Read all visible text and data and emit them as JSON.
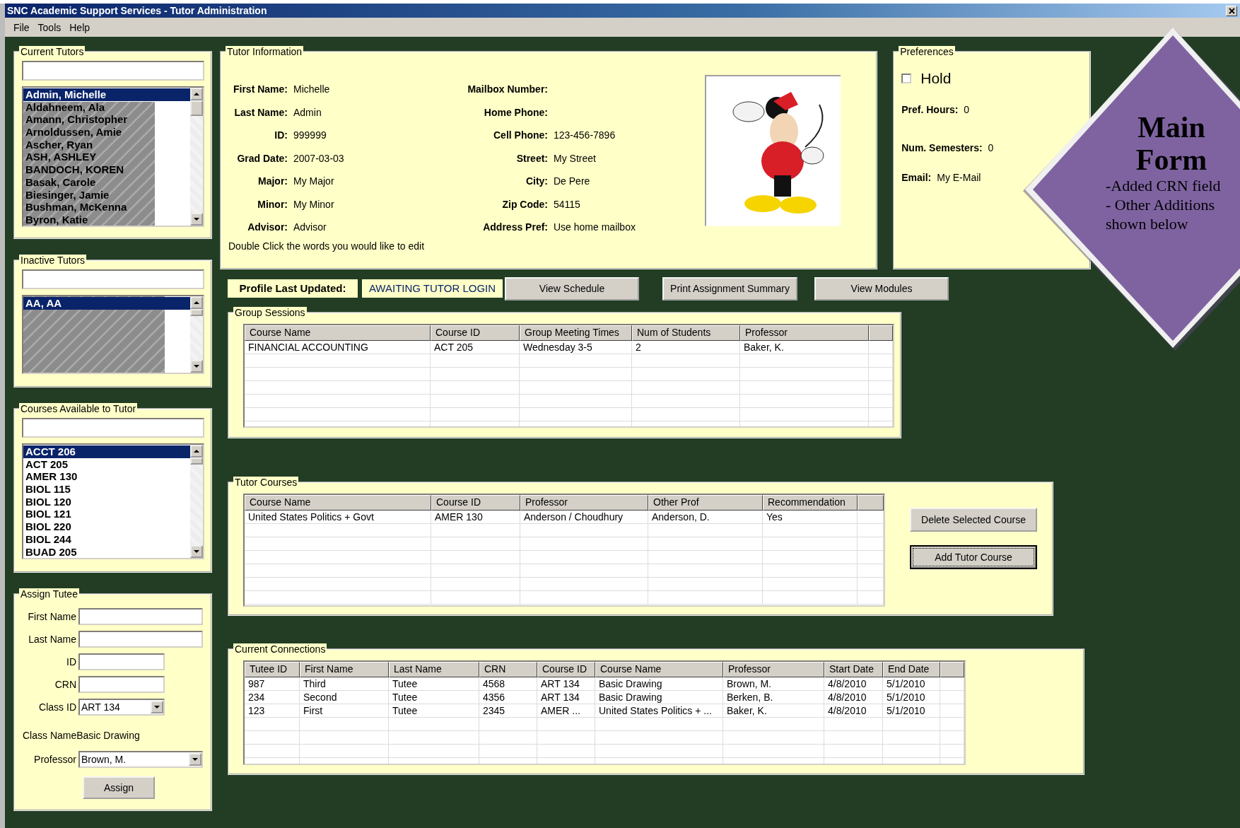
{
  "window": {
    "title": "SNC Academic Support Services - Tutor Administration"
  },
  "menu": [
    {
      "label": "File"
    },
    {
      "label": "Tools"
    },
    {
      "label": "Help"
    }
  ],
  "current_tutors": {
    "title": "Current Tutors",
    "items": [
      {
        "label": "Admin, Michelle",
        "selected": true
      },
      {
        "label": "Aldahneem, Ala",
        "selected": false
      },
      {
        "label": "Amann, Christopher",
        "selected": false
      },
      {
        "label": "Arnoldussen, Amie",
        "selected": false
      },
      {
        "label": "Ascher, Ryan",
        "selected": false
      },
      {
        "label": "ASH, ASHLEY",
        "selected": false
      },
      {
        "label": "BANDOCH, KOREN",
        "selected": false
      },
      {
        "label": "Basak, Carole",
        "selected": false
      },
      {
        "label": "Biesinger, Jamie",
        "selected": false
      },
      {
        "label": "Bushman, McKenna",
        "selected": false
      },
      {
        "label": "Byron, Katie",
        "selected": false
      }
    ]
  },
  "inactive_tutors": {
    "title": "Inactive Tutors",
    "items": [
      {
        "label": "AA, AA",
        "selected": true
      }
    ]
  },
  "courses_available": {
    "title": "Courses Available to Tutor",
    "items": [
      {
        "label": "ACCT 206",
        "selected": true
      },
      {
        "label": "ACT 205",
        "selected": false
      },
      {
        "label": "AMER 130",
        "selected": false
      },
      {
        "label": "BIOL 115",
        "selected": false
      },
      {
        "label": "BIOL 120",
        "selected": false
      },
      {
        "label": "BIOL 121",
        "selected": false
      },
      {
        "label": "BIOL 220",
        "selected": false
      },
      {
        "label": "BIOL 244",
        "selected": false
      },
      {
        "label": "BUAD 205",
        "selected": false
      }
    ]
  },
  "assign_tutee": {
    "title": "Assign Tutee",
    "fields": [
      {
        "label": "First Name",
        "kind": "text"
      },
      {
        "label": "Last Name",
        "kind": "text"
      },
      {
        "label": "ID",
        "kind": "short_text"
      },
      {
        "label": "CRN",
        "kind": "short_text"
      },
      {
        "label": "Class ID",
        "kind": "short_select",
        "value": "ART 134"
      }
    ],
    "class_name": {
      "label": "Class Name",
      "value": "Basic Drawing"
    },
    "professor": {
      "label": "Professor",
      "kind": "select",
      "value": "Brown, M."
    },
    "button": "Assign"
  },
  "tutor_info": {
    "title": "Tutor Information",
    "fields_left": [
      {
        "label": "First Name:",
        "value": "Michelle"
      },
      {
        "label": "Last Name:",
        "value": "Admin"
      },
      {
        "label": "ID:",
        "value": "999999"
      },
      {
        "label": "Grad Date:",
        "value": "2007-03-03"
      },
      {
        "label": "Major:",
        "value": "My Major"
      },
      {
        "label": "Minor:",
        "value": "My Minor"
      },
      {
        "label": "Advisor:",
        "value": "Advisor"
      }
    ],
    "fields_right": [
      {
        "label": "Mailbox Number:"
      },
      {
        "label": "Home Phone:"
      },
      {
        "label": "Cell Phone:",
        "value": "123-456-7896"
      },
      {
        "label": "Street:",
        "value": "My Street"
      },
      {
        "label": "City:",
        "value": "De Pere"
      },
      {
        "label": "Zip Code:",
        "value": "54115"
      },
      {
        "label": "Address Pref:",
        "value": "Use home mailbox"
      }
    ],
    "hint": "Double Click the words you would like to edit"
  },
  "preferences": {
    "title": "Preferences",
    "hold": {
      "label": "Hold",
      "checked": false
    },
    "fields": [
      {
        "label": "Pref. Hours:",
        "value": "0"
      },
      {
        "label": "Num. Semesters:",
        "value": "0"
      },
      {
        "label": "Email:",
        "value": "My E-Mail"
      }
    ]
  },
  "profile_updated": {
    "label": "Profile Last Updated:",
    "value": "AWAITING TUTOR LOGIN"
  },
  "actions": [
    "View Schedule",
    "Print Assignment Summary",
    "View Modules"
  ],
  "group_sessions": {
    "title": "Group Sessions",
    "columns": [
      "Course Name",
      "Course ID",
      "Group Meeting Times",
      "Num of Students",
      "Professor"
    ],
    "rows": [
      [
        "FINANCIAL ACCOUNTING",
        "ACT 205",
        "Wednesday 3-5",
        "2",
        "Baker, K."
      ]
    ]
  },
  "tutor_courses": {
    "title": "Tutor Courses",
    "columns": [
      "Course Name",
      "Course ID",
      "Professor",
      "Other Prof",
      "Recommendation"
    ],
    "rows": [
      [
        "United States Politics + Govt",
        "AMER 130",
        "Anderson / Choudhury",
        "Anderson, D.",
        "Yes"
      ]
    ],
    "buttons": [
      {
        "label": "Delete Selected Course",
        "focused": false
      },
      {
        "label": "Add Tutor Course",
        "focused": true
      }
    ]
  },
  "current_connections": {
    "title": "Current Connections",
    "columns": [
      "Tutee ID",
      "First Name",
      "Last Name",
      "CRN",
      "Course ID",
      "Course Name",
      "Professor",
      "Start Date",
      "End Date"
    ],
    "rows": [
      [
        "987",
        "Third",
        "Tutee",
        "4568",
        "ART 134",
        "Basic Drawing",
        "Brown, M.",
        "4/8/2010",
        "5/1/2010"
      ],
      [
        "234",
        "Second",
        "Tutee",
        "4356",
        "ART 134",
        "Basic Drawing",
        "Berken, B.",
        "4/8/2010",
        "5/1/2010"
      ],
      [
        "123",
        "First",
        "Tutee",
        "2345",
        "AMER ...",
        "United States Politics + ...",
        "Baker, K.",
        "4/8/2010",
        "5/1/2010"
      ]
    ]
  },
  "annotation": {
    "title": [
      "Main",
      "Form"
    ],
    "lines": [
      "-Added CRN field",
      "- Other Additions",
      "shown below"
    ]
  }
}
